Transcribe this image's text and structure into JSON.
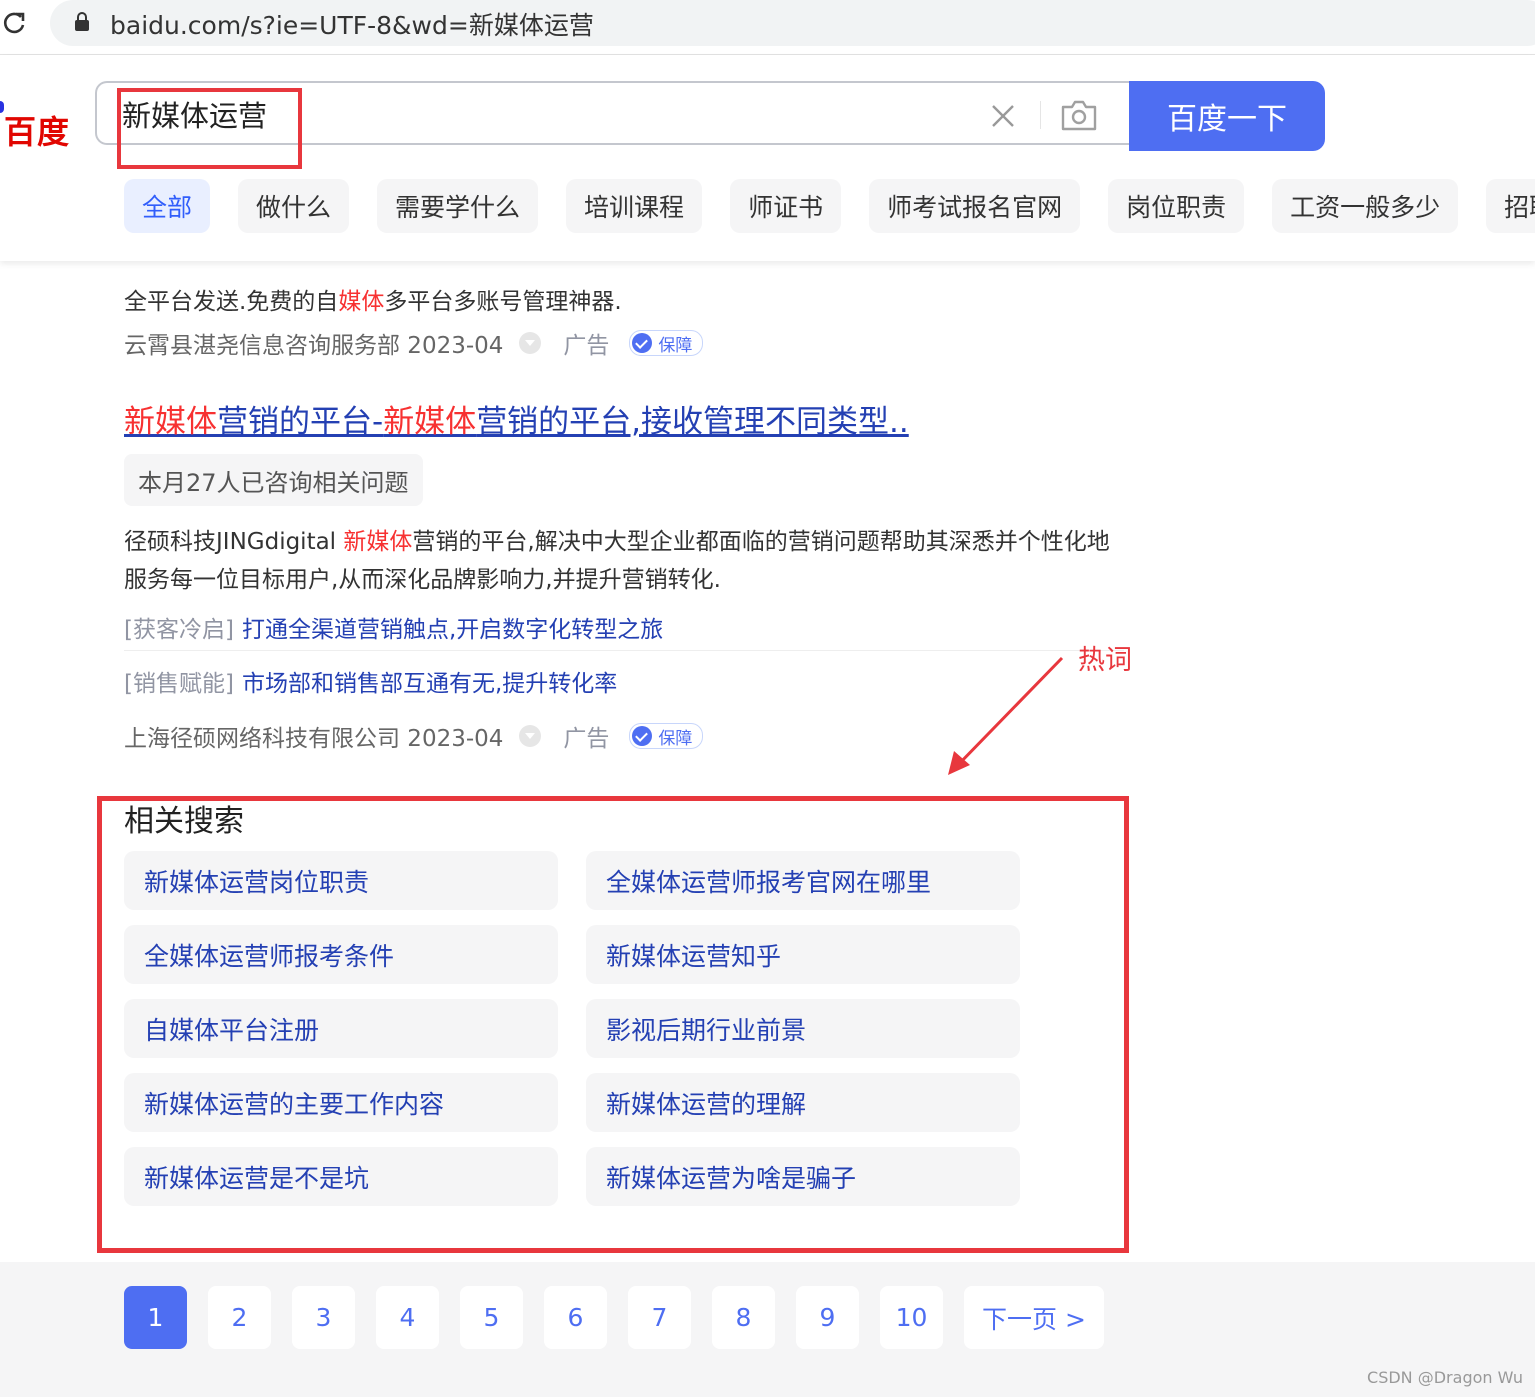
{
  "browser": {
    "url": "baidu.com/s?ie=UTF-8&wd=新媒体运营"
  },
  "header": {
    "logo": "百度",
    "query": "新媒体运营",
    "search_button": "百度一下",
    "tabs": [
      {
        "label": "全部",
        "active": true
      },
      {
        "label": "做什么"
      },
      {
        "label": "需要学什么"
      },
      {
        "label": "培训课程"
      },
      {
        "label": "师证书"
      },
      {
        "label": "师考试报名官网"
      },
      {
        "label": "岗位职责"
      },
      {
        "label": "工资一般多少"
      },
      {
        "label": "招聘"
      }
    ]
  },
  "result1": {
    "desc_a": "全平台发送.免费的自",
    "desc_em": "媒体",
    "desc_b": "多平台多账号管理神器.",
    "source": "云霄县湛尧信息咨询服务部 2023-04",
    "ad": "广告",
    "badge": "保障"
  },
  "result2": {
    "title_em1": "新媒体",
    "title_a": "营销的平台-",
    "title_em2": "新媒体",
    "title_b": "营销的平台,接收管理不同类型..",
    "consult": "本月27人已咨询相关问题",
    "desc1_a": "径硕科技JINGdigital ",
    "desc1_em": "新媒体",
    "desc1_b": "营销的平台,解决中大型企业都面临的营销问题帮助其深悉并个性化地",
    "desc2": "服务每一位目标用户,从而深化品牌影响力,并提升营销转化.",
    "link1_tag": "[获客冷启]",
    "link1": "打通全渠道营销触点,开启数字化转型之旅",
    "link2_tag": "[销售赋能]",
    "link2": "市场部和销售部互通有无,提升转化率",
    "source": "上海径硕网络科技有限公司 2023-04",
    "ad": "广告",
    "badge": "保障"
  },
  "related": {
    "title": "相关搜索",
    "items": [
      "新媒体运营岗位职责",
      "全媒体运营师报考官网在哪里",
      "全媒体运营师报考条件",
      "新媒体运营知乎",
      "自媒体平台注册",
      "影视后期行业前景",
      "新媒体运营的主要工作内容",
      "新媒体运营的理解",
      "新媒体运营是不是坑",
      "新媒体运营为啥是骗子"
    ]
  },
  "annotation": {
    "label": "热词",
    "color": "#e8373d"
  },
  "pagination": {
    "pages": [
      "1",
      "2",
      "3",
      "4",
      "5",
      "6",
      "7",
      "8",
      "9",
      "10"
    ],
    "current": "1",
    "next": "下一页 >"
  },
  "watermark": "CSDN @Dragon   Wu"
}
